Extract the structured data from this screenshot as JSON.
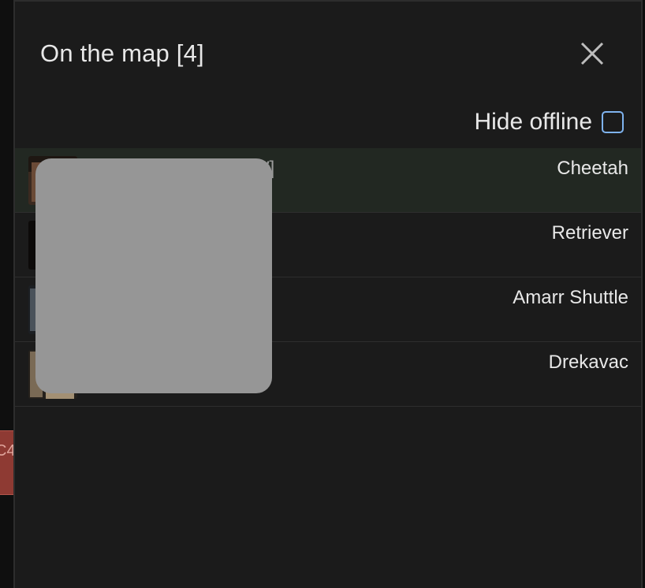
{
  "map": {
    "marker_text": "C4"
  },
  "panel": {
    "title": "On the map [4]",
    "close_icon": "close-icon",
    "hide_offline_label": "Hide offline",
    "hide_offline_checked": false,
    "accent_color": "#7fb3ef"
  },
  "rows": [
    {
      "name_tail": "W]",
      "ship": "Cheetah",
      "active": true
    },
    {
      "name_tail": "",
      "ship": "Retriever",
      "active": false
    },
    {
      "name_tail": "",
      "ship": "Amarr Shuttle",
      "active": false
    },
    {
      "name_tail": "",
      "ship": "Drekavac",
      "active": false
    }
  ]
}
